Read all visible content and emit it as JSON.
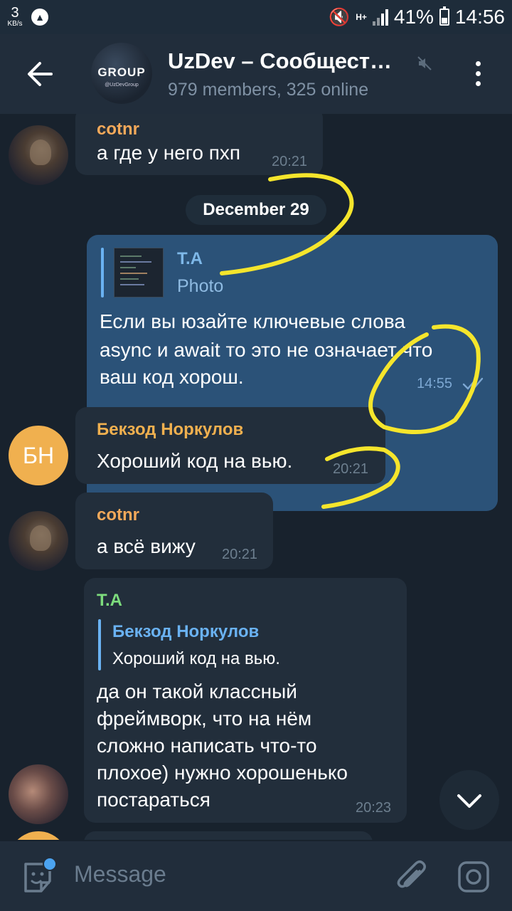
{
  "status_bar": {
    "net_speed": "3",
    "net_speed_unit": "KB/s",
    "network_type": "H+",
    "battery": "41%",
    "battery_level": 0.41,
    "time": "14:56"
  },
  "header": {
    "avatar_text": "GROUP",
    "avatar_sub": "@UzDevGroup",
    "title": "UzDev – Сообщест…",
    "subtitle": "979 members, 325 online"
  },
  "messages": [
    {
      "sender": "cotnr",
      "text": "а где у него пхп",
      "time": "20:21"
    },
    {
      "date": "December 29"
    },
    {
      "reply_name": "T.A",
      "reply_text": "Photo",
      "text_lines": [
        "Если вы юзайте ключевые слова",
        "async и await то это не означает что",
        "ваш код хорош."
      ],
      "time": "14:55",
      "status": "read"
    },
    {
      "sender": "Бекзод Норкулов",
      "avatar_initials": "БН",
      "text": "Хороший код на вью.",
      "time": "20:21"
    },
    {
      "sender": "cotnr",
      "text": "а всё вижу",
      "time": "20:21"
    },
    {
      "sender": "T.A",
      "reply_name": "Бекзод Норкулов",
      "reply_text": "Хороший код на вью.",
      "text_lines": [
        "да он такой классный",
        "фреймворк, что на нём",
        "сложно написать что-то",
        "плохое) нужно хорошенько",
        "постараться"
      ],
      "time": "20:23"
    }
  ],
  "input": {
    "placeholder": "Message"
  },
  "colors": {
    "background": "#18222d",
    "incoming_bubble": "#222e3b",
    "outgoing_bubble": "#2b5278",
    "sender_cotnr": "#f4a95a",
    "sender_bekzod": "#f0b04f",
    "sender_ta": "#7ddc7d",
    "reply_accent": "#6ab2f2",
    "annotation": "#f5e52c"
  }
}
